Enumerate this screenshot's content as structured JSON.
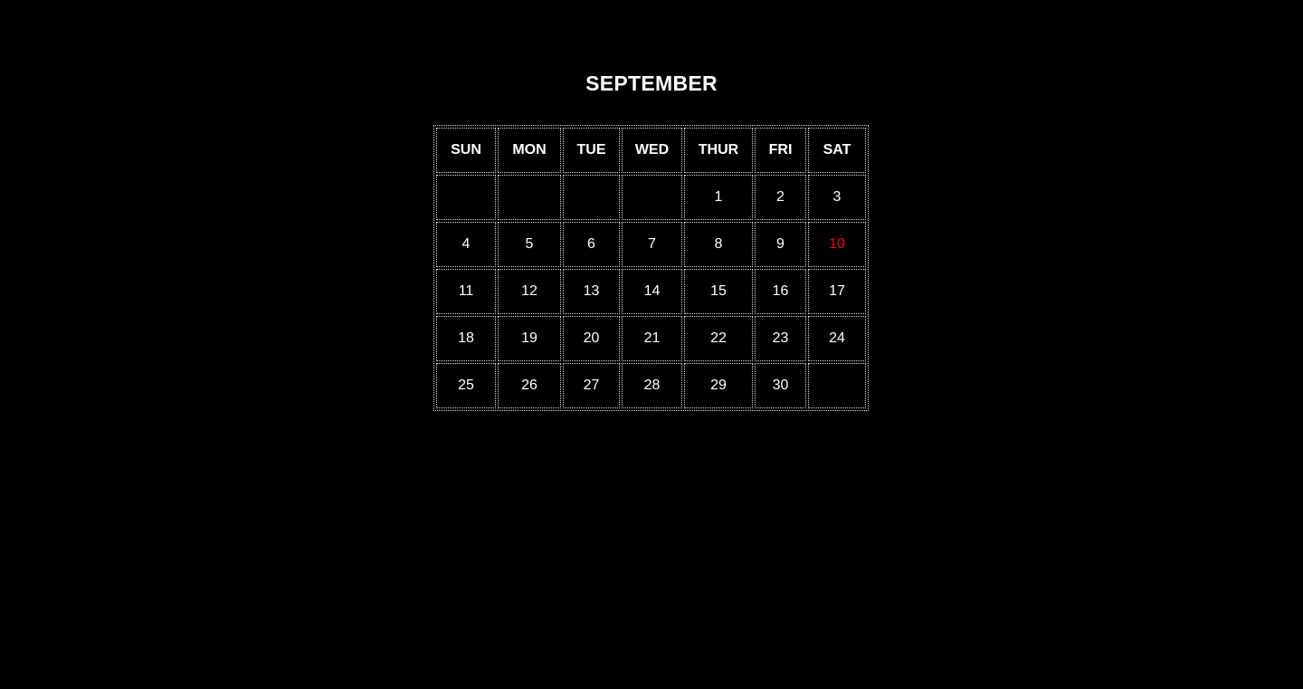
{
  "calendar": {
    "month": "SEPTEMBER",
    "weekdays": [
      "SUN",
      "MON",
      "TUE",
      "WED",
      "THUR",
      "FRI",
      "SAT"
    ],
    "weeks": [
      [
        "",
        "",
        "",
        "",
        "1",
        "2",
        "3"
      ],
      [
        "4",
        "5",
        "6",
        "7",
        "8",
        "9",
        "10"
      ],
      [
        "11",
        "12",
        "13",
        "14",
        "15",
        "16",
        "17"
      ],
      [
        "18",
        "19",
        "20",
        "21",
        "22",
        "23",
        "24"
      ],
      [
        "25",
        "26",
        "27",
        "28",
        "29",
        "30",
        ""
      ]
    ],
    "highlighted_day": "10",
    "highlight_color": "#ff0000",
    "text_color": "#ffffff",
    "background_color": "#000000"
  }
}
